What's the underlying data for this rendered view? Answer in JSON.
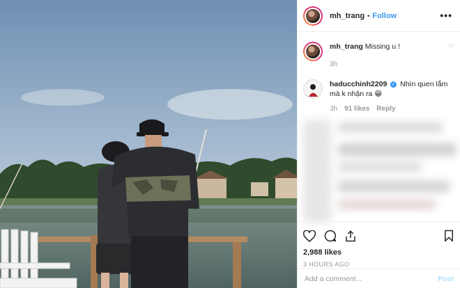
{
  "header": {
    "username": "mh_trang",
    "separator": "•",
    "follow_label": "Follow",
    "more_label": "•••"
  },
  "caption": {
    "username": "mh_trang",
    "text": "Missing u !",
    "age": "3h"
  },
  "comments": [
    {
      "username": "haducchinh2209",
      "verified_mark": "✓",
      "text": "Nhìn quen lắm mà k nhận ra 😁",
      "age": "3h",
      "likes": "91 likes",
      "reply_label": "Reply",
      "heart": "♡"
    }
  ],
  "actions": {
    "like_icon": "heart-icon",
    "comment_icon": "comment-icon",
    "share_icon": "share-icon",
    "save_icon": "bookmark-icon"
  },
  "stats": {
    "likes": "2,988 likes",
    "timestamp": "3 HOURS AGO"
  },
  "composer": {
    "placeholder": "Add a comment...",
    "post_label": "Post"
  },
  "colors": {
    "link": "#3897f0",
    "muted": "#999999",
    "post_disabled": "#b2dffc"
  }
}
